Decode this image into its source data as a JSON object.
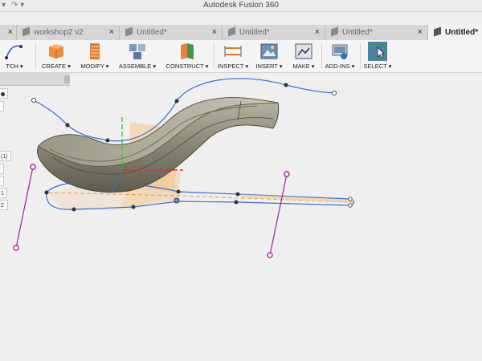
{
  "titlebar": {
    "title": "Autodesk Fusion 360",
    "redo_glyph": "↷ ▾"
  },
  "tabs": [
    {
      "label": "workshop2 v2",
      "active": false
    },
    {
      "label": "Untitled*",
      "active": false
    },
    {
      "label": "Untitled*",
      "active": false
    },
    {
      "label": "Untitled*",
      "active": false
    },
    {
      "label": "Untitled*",
      "active": true
    }
  ],
  "toolbar": {
    "sketch": "TCH ▾",
    "create": "CREATE ▾",
    "modify": "MODIFY ▾",
    "assemble": "ASSEMBLE ▾",
    "construct": "CONSTRUCT ▾",
    "inspect": "INSPECT ▾",
    "insert": "INSERT ▾",
    "make": "MAKE ▾",
    "addins": "ADD-INS ▾",
    "select": "SELECT ▾"
  },
  "browser": {
    "items": [
      "(1)",
      "1",
      "2"
    ]
  },
  "colors": {
    "curve": "#3a6fd8",
    "handle": "#a0239a",
    "body": "#85826f",
    "plane": "#f2c98a",
    "accent": "#5b8fc7"
  }
}
